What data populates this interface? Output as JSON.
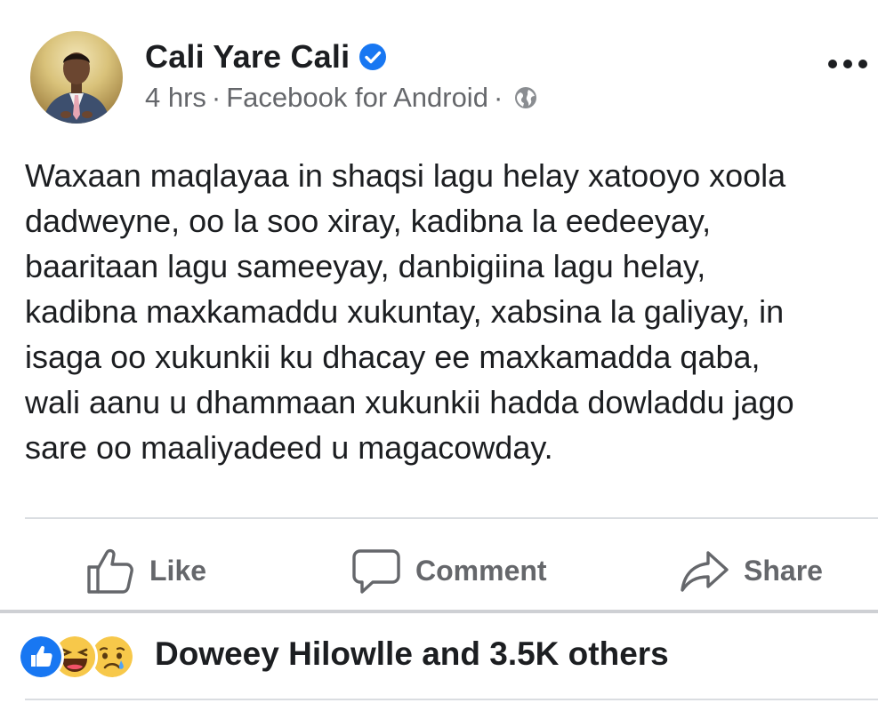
{
  "post": {
    "author": {
      "name": "Cali Yare Cali",
      "verified": true
    },
    "meta": {
      "time": "4 hrs",
      "source": "Facebook for Android",
      "separator": "·",
      "privacy_icon": "globe-icon"
    },
    "text": "Waxaan maqlayaa in shaqsi lagu helay xatooyo xoola\ndadweyne, oo la soo xiray, kadibna la eedeeyay,\nbaaritaan lagu sameeyay, danbigiina lagu helay,\nkadibna maxkamaddu xukuntay, xabsina la galiyay, in\nisaga oo xukunkii ku dhacay ee maxkamadda qaba,\nwali aanu u dhammaan xukunkii hadda dowladdu jago\nsare oo maaliyadeed u magacowday."
  },
  "actions": {
    "like_label": "Like",
    "comment_label": "Comment",
    "share_label": "Share"
  },
  "reactions": {
    "icons": [
      "like-icon",
      "haha-icon",
      "sad-icon"
    ],
    "summary": "Doweey Hilowlle and 3.5K others"
  },
  "colors": {
    "verified_blue": "#1877f2",
    "secondary_text": "#65676b",
    "like_blue": "#1877f2",
    "emoji_yellow": "#f7c84a"
  }
}
